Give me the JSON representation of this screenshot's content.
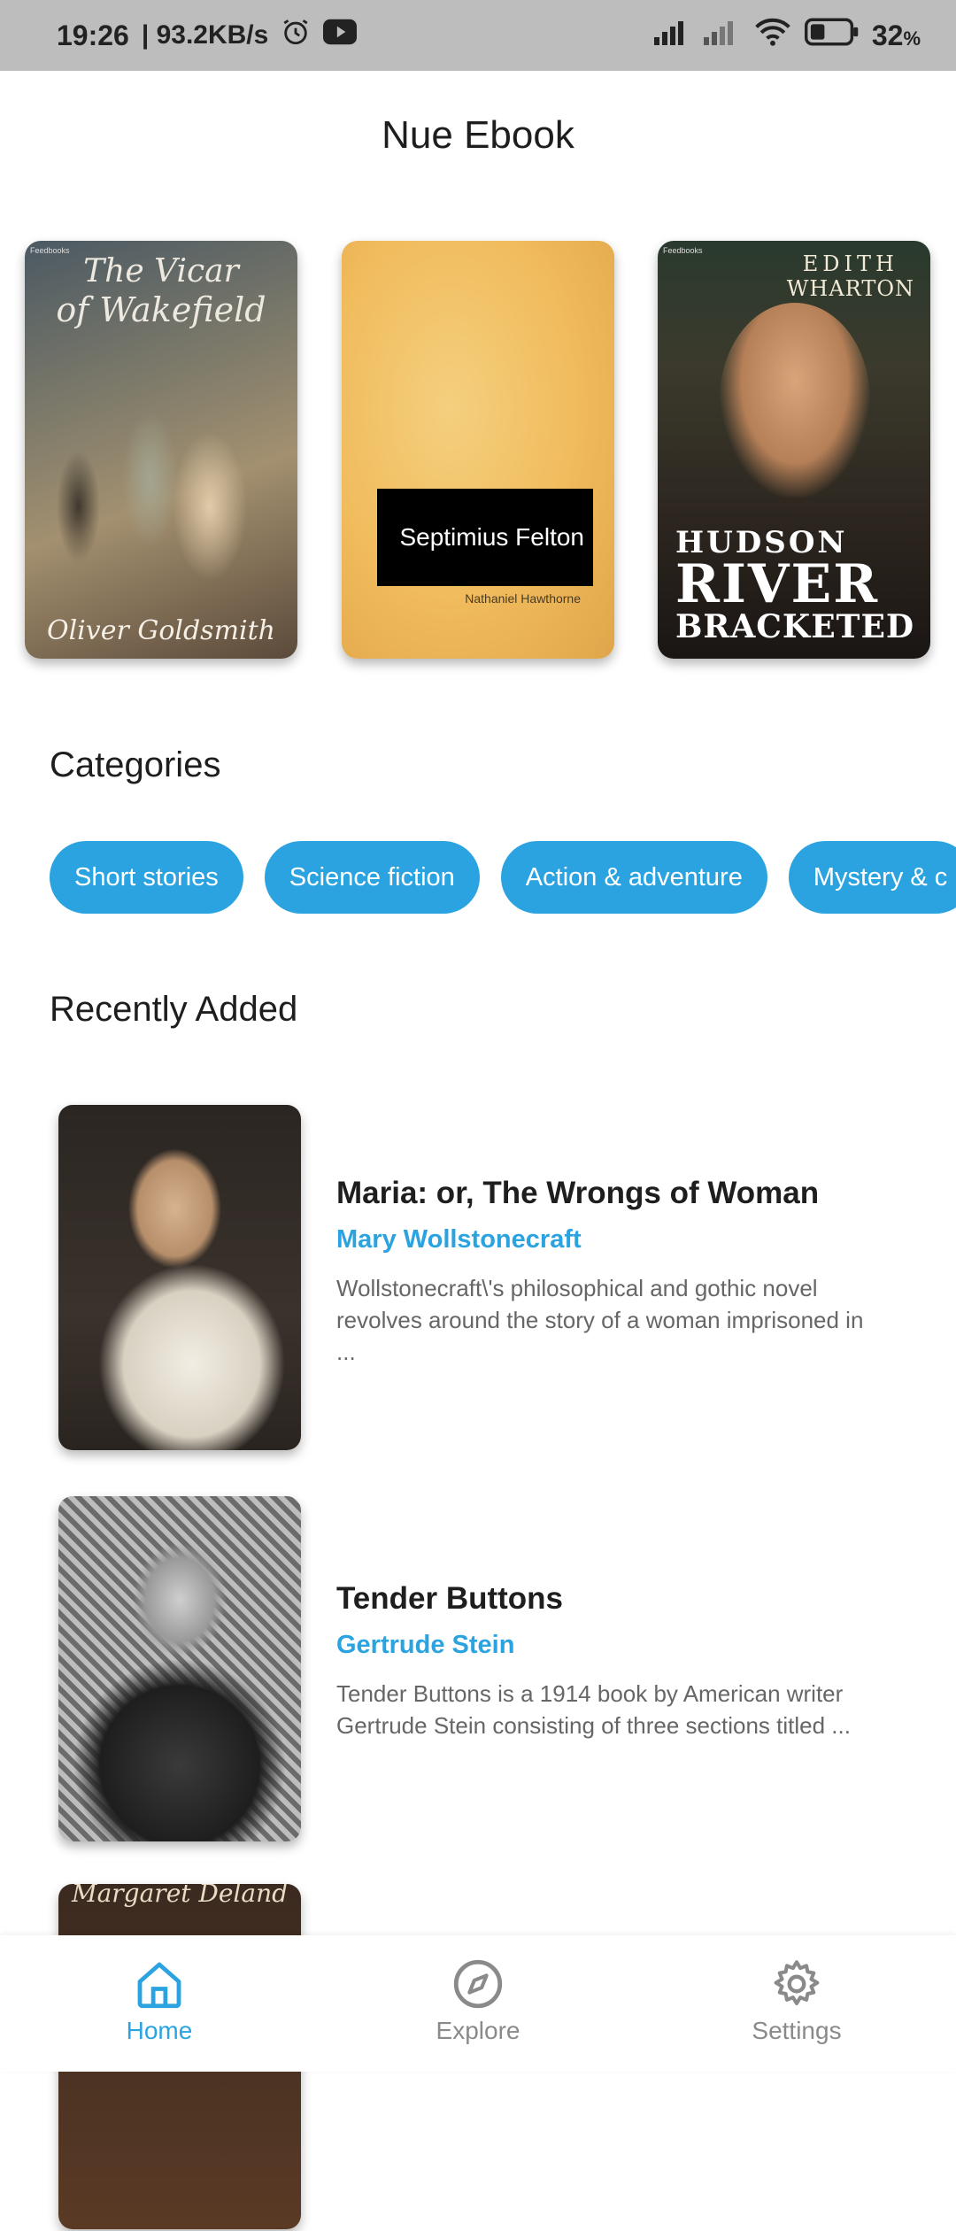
{
  "status_bar": {
    "time": "19:26",
    "speed": "| 93.2KB/s",
    "battery": "32",
    "battery_unit": "%"
  },
  "app": {
    "title": "Nue Ebook"
  },
  "featured": [
    {
      "title_line1": "The Vicar",
      "title_line2": "of Wakefield",
      "author": "Oliver Goldsmith",
      "publisher": "Feedbooks"
    },
    {
      "title": "Septimius Felton",
      "author": "Nathaniel Hawthorne"
    },
    {
      "author_line1": "EDITH",
      "author_line2": "WHARTON",
      "title_line1": "HUDSON",
      "title_line2": "RIVER",
      "title_line3": "BRACKETED",
      "publisher": "Feedbooks"
    }
  ],
  "categories": {
    "title": "Categories",
    "items": [
      "Short stories",
      "Science fiction",
      "Action & adventure",
      "Mystery & c"
    ]
  },
  "recent": {
    "title": "Recently Added",
    "items": [
      {
        "title": "Maria: or, The Wrongs of Woman",
        "author": "Mary Wollstonecraft",
        "description": "Wollstonecraft\\'s philosophical and gothic novel revolves around the story of a woman imprisoned in ..."
      },
      {
        "title": "Tender Buttons",
        "author": "Gertrude Stein",
        "description": "Tender Buttons is a 1914 book by American writer Gertrude Stein consisting of three sections titled ..."
      },
      {
        "cover_text": "Margaret Deland"
      }
    ]
  },
  "nav": {
    "home": "Home",
    "explore": "Explore",
    "settings": "Settings"
  },
  "colors": {
    "accent": "#2aa3e0",
    "status_bar": "#bdbdbd"
  },
  "icons": [
    "alarm-icon",
    "youtube-icon",
    "signal-icon",
    "wifi-icon",
    "battery-icon",
    "home-icon",
    "compass-icon",
    "gear-icon"
  ]
}
